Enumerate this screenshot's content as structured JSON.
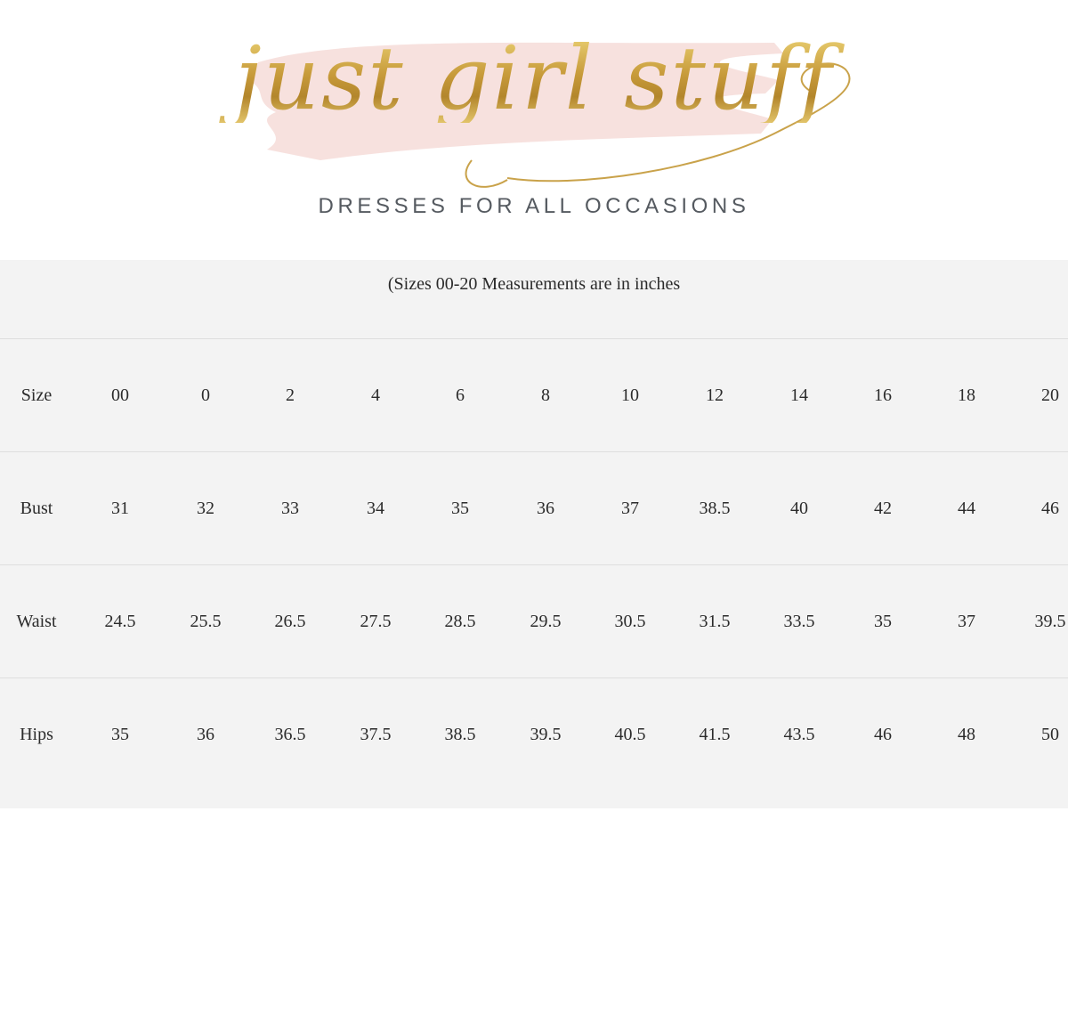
{
  "brand": {
    "logo_text": "just girl stuff",
    "tagline": "DRESSES FOR ALL OCCASIONS",
    "colors": {
      "gold": "#c9a24a",
      "blush": "#f6dcd8",
      "tagline": "#555a60"
    }
  },
  "size_chart": {
    "caption": "(Sizes 00-20 Measurements are in inches",
    "rows": [
      {
        "label": "Size",
        "values": [
          "00",
          "0",
          "2",
          "4",
          "6",
          "8",
          "10",
          "12",
          "14",
          "16",
          "18",
          "20"
        ]
      },
      {
        "label": "Bust",
        "values": [
          "31",
          "32",
          "33",
          "34",
          "35",
          "36",
          "37",
          "38.5",
          "40",
          "42",
          "44",
          "46"
        ]
      },
      {
        "label": "Waist",
        "values": [
          "24.5",
          "25.5",
          "26.5",
          "27.5",
          "28.5",
          "29.5",
          "30.5",
          "31.5",
          "33.5",
          "35",
          "37",
          "39.5"
        ]
      },
      {
        "label": "Hips",
        "values": [
          "35",
          "36",
          "36.5",
          "37.5",
          "38.5",
          "39.5",
          "40.5",
          "41.5",
          "43.5",
          "46",
          "48",
          "50"
        ]
      }
    ],
    "colors": {
      "background": "#f3f3f3",
      "divider": "#dedede",
      "text": "#2b2b2b"
    }
  }
}
